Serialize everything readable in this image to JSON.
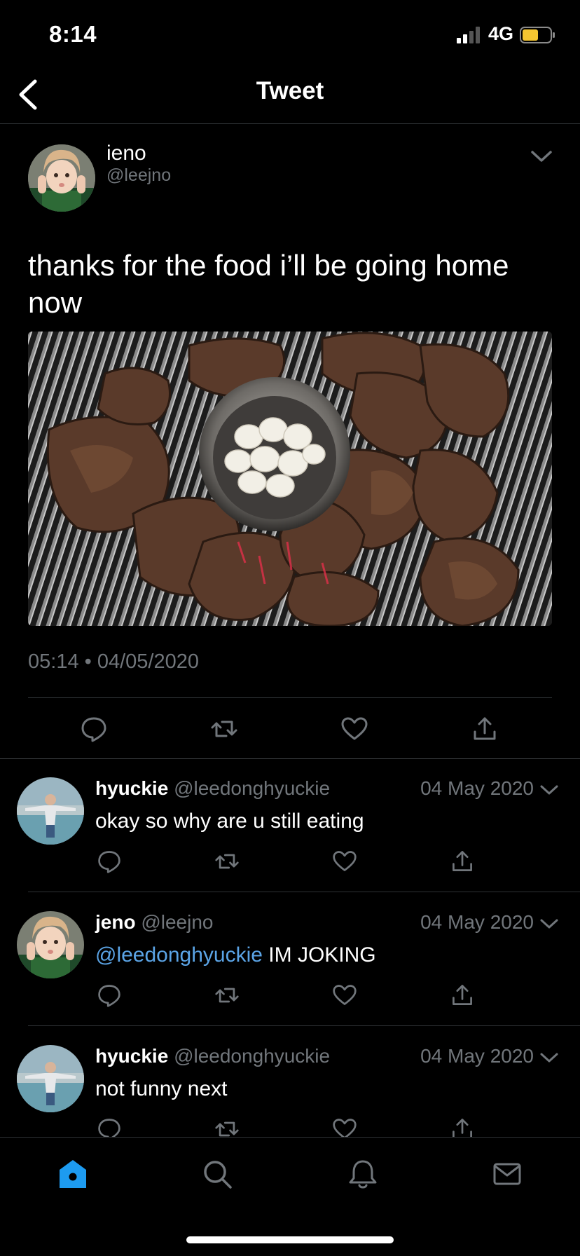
{
  "status_bar": {
    "time": "8:14",
    "network": "4G",
    "battery_color": "#f5c631"
  },
  "nav": {
    "title": "Tweet"
  },
  "main_tweet": {
    "name": "ieno",
    "handle": "@leejno",
    "text": "thanks for the food i’ll be going home now",
    "time": "05:14",
    "date": "04/05/2020",
    "separator": "•"
  },
  "replies": [
    {
      "name": "hyuckie",
      "handle": "@leedonghyuckie",
      "date": "04 May 2020",
      "mention": "",
      "text": "okay so why are u still eating"
    },
    {
      "name": "jeno",
      "handle": "@leejno",
      "date": "04 May 2020",
      "mention": "@leedonghyuckie",
      "text": "IM JOKING"
    },
    {
      "name": "hyuckie",
      "handle": "@leedonghyuckie",
      "date": "04 May 2020",
      "mention": "",
      "text": "not funny next"
    }
  ],
  "tabs": [
    "home-icon",
    "search-icon",
    "notifications-icon",
    "messages-icon"
  ],
  "colors": {
    "accent": "#1d9bf0",
    "mention": "#5ba4e6",
    "muted": "#71767b",
    "divider": "#2f3336"
  }
}
